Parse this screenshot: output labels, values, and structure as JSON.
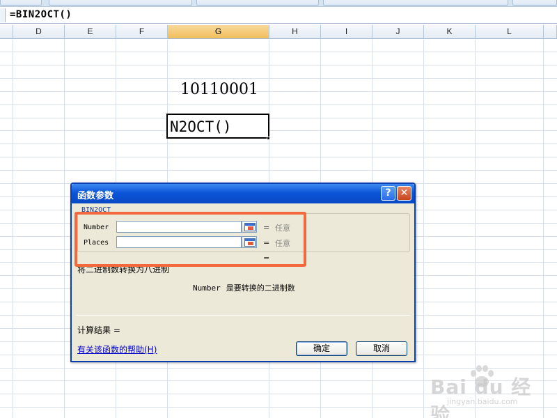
{
  "formula_bar": {
    "text": "=BIN2OCT()"
  },
  "columns": [
    {
      "letter": "D",
      "active": false
    },
    {
      "letter": "E",
      "active": false
    },
    {
      "letter": "F",
      "active": false
    },
    {
      "letter": "G",
      "active": true
    },
    {
      "letter": "H",
      "active": false
    },
    {
      "letter": "I",
      "active": false
    },
    {
      "letter": "J",
      "active": false
    },
    {
      "letter": "K",
      "active": false
    },
    {
      "letter": "L",
      "active": false
    }
  ],
  "cells": {
    "g_value": "10110001",
    "g_edit": "N2OCT()"
  },
  "dialog": {
    "title": "函数参数",
    "help_icon": "?",
    "close_icon": "✕",
    "function_name": "BIN2OCT",
    "args": [
      {
        "label": "Number",
        "value": "",
        "equals": "=",
        "result": "任意"
      },
      {
        "label": "Places",
        "value": "",
        "equals": "=",
        "result": "任意"
      }
    ],
    "formula_equals": "=",
    "description": "将二进制数转换为八进制",
    "arg_desc_name": "Number",
    "arg_desc_text": "是要转换的二进制数",
    "calc_label": "计算结果 =",
    "help_link": "有关该函数的帮助(H)",
    "ok_label": "确定",
    "cancel_label": "取消"
  },
  "colors": {
    "highlight": "#f26a3b",
    "title_bar": "#0b55d8",
    "active_column": "#f1be5c"
  },
  "watermark": {
    "text": "Bai du 经验",
    "sub": "jingyan.baidu.com"
  }
}
